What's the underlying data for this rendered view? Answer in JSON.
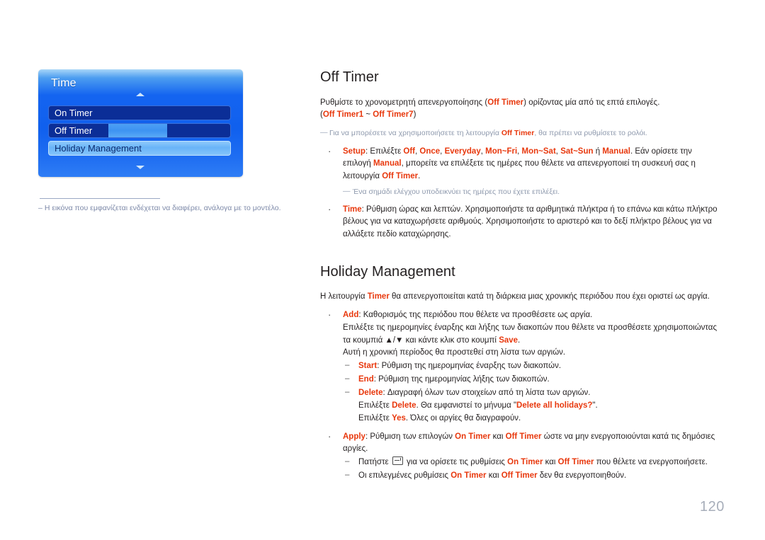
{
  "osd": {
    "title": "Time",
    "scroll_up_icon": "caret-up-icon",
    "scroll_down_icon": "caret-down-icon",
    "rows": [
      {
        "label": "On Timer",
        "state": "normal"
      },
      {
        "label": "Off Timer",
        "state": "value-bar"
      },
      {
        "label": "Holiday Management",
        "state": "selected"
      }
    ]
  },
  "left_note": {
    "dash": "–",
    "text": "Η εικόνα που εμφανίζεται ενδέχεται να διαφέρει, ανάλογα με το μοντέλο."
  },
  "sections": {
    "off_timer": {
      "title": "Off Timer",
      "intro_a": "Ρυθμίστε το χρονομετρητή απενεργοποίησης (",
      "intro_a_red": "Off Timer",
      "intro_b": ") ορίζοντας μία από τις επτά επιλογές.",
      "intro_c_open": "(",
      "intro_c_red1": "Off Timer1",
      "intro_c_mid": " ~ ",
      "intro_c_red2": "Off Timer7",
      "intro_c_close": ")",
      "note1_a": "Για να μπορέσετε να χρησιμοποιήσετε τη λειτουργία ",
      "note1_red": "Off Timer",
      "note1_b": ", θα πρέπει να ρυθμίσετε το ρολόι.",
      "bullets": [
        {
          "label": "Setup",
          "text_a": ": Επιλέξτε ",
          "opts": [
            "Off",
            "Once",
            "Everyday",
            "Mon~Fri",
            "Mon~Sat",
            "Sat~Sun"
          ],
          "opts_sep": ", ",
          "or_word": " ή ",
          "opt_last": "Manual",
          "text_b": ". Εάν ορίσετε την επιλογή ",
          "red2": "Manual",
          "text_c": ", μπορείτε να επιλέξετε τις ημέρες που θέλετε να απενεργοποιεί τη συσκευή σας η λειτουργία ",
          "red3": "Off Timer",
          "text_d": ".",
          "note_a": "Ένα σημάδι ελέγχου υποδεικνύει τις ημέρες που έχετε επιλέξει."
        },
        {
          "label": "Time",
          "text_a": ": Ρύθμιση ώρας και λεπτών. Χρησιμοποιήστε τα αριθμητικά πλήκτρα ή το επάνω και κάτω πλήκτρο βέλους για να καταχωρήσετε αριθμούς. Χρησιμοποιήστε το αριστερό και το δεξί πλήκτρο βέλους για να αλλάξετε πεδίο καταχώρησης."
        }
      ]
    },
    "holiday_management": {
      "title": "Holiday Management",
      "intro_a": "Η λειτουργία ",
      "intro_red": "Timer",
      "intro_b": " θα απενεργοποιείται κατά τη διάρκεια μιας χρονικής περιόδου που έχει οριστεί ως αργία.",
      "add": {
        "label": "Add",
        "text_a": ": Καθορισμός της περιόδου που θέλετε να προσθέσετε ως αργία.",
        "line2_a": "Επιλέξτε τις ημερομηνίες έναρξης και λήξης των διακοπών που θέλετε να προσθέσετε χρησιμοποιώντας τα κουμπιά ▲/▼ και κάντε κλικ στο κουμπί ",
        "line2_red": "Save",
        "line2_b": ".",
        "line3": "Αυτή η χρονική περίοδος θα προστεθεί στη λίστα των αργιών.",
        "subs": [
          {
            "label": "Start",
            "text": ": Ρύθμιση της ημερομηνίας έναρξης των διακοπών."
          },
          {
            "label": "End",
            "text": ": Ρύθμιση της ημερομηνίας λήξης των διακοπών."
          },
          {
            "label": "Delete",
            "text": ": Διαγραφή όλων των στοιχείων από τη λίστα των αργιών.",
            "extra1_a": "Επιλέξτε ",
            "extra1_red": "Delete",
            "extra1_b": ". Θα εμφανιστεί το μήνυμα \"",
            "extra1_red2": "Delete all holidays?",
            "extra1_c": "\".",
            "extra2_a": "Επιλέξτε ",
            "extra2_red": "Yes",
            "extra2_b": ". Όλες οι αργίες θα διαγραφούν."
          }
        ]
      },
      "apply": {
        "label": "Apply",
        "text_a": ": Ρύθμιση των επιλογών ",
        "red1": "On Timer",
        "and1": " και ",
        "red2": "Off Timer",
        "text_b": " ώστε να μην ενεργοποιούνται κατά τις δημόσιες αργίες.",
        "subs": [
          {
            "pre": "Πατήστε ",
            "icon": "enter-key-icon",
            "mid_a": " για να ορίσετε τις ρυθμίσεις ",
            "red1": "On Timer",
            "and": " και ",
            "red2": "Off Timer",
            "post": " που θέλετε να ενεργοποιήσετε."
          },
          {
            "pre": "Οι επιλεγμένες ρυθμίσεις ",
            "red1": "On Timer",
            "and": " και ",
            "red2": "Off Timer",
            "post": " δεν θα ενεργοποιηθούν."
          }
        ]
      }
    }
  },
  "page_number": "120",
  "colors": {
    "accent_red": "#e8380d",
    "note_gray": "#8e99ad",
    "page_number_gray": "#a7aeba",
    "osd_blue": "#1464f0",
    "osd_row_dark": "#0b2e97",
    "osd_row_selected": "#69b4f8"
  }
}
